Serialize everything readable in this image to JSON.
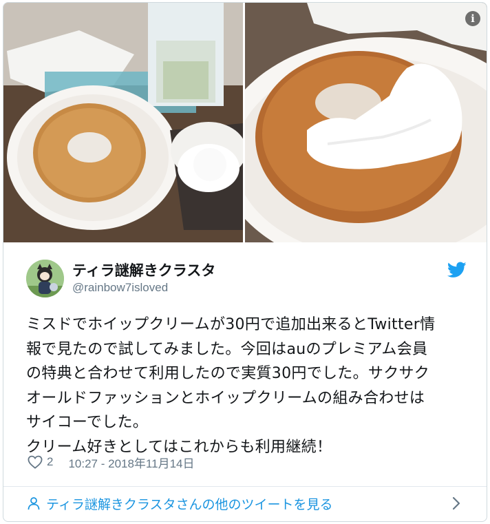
{
  "media": {
    "left_alt": "donut-and-cream-photo",
    "right_alt": "donut-with-whipped-cream-photo",
    "info_glyph": "i"
  },
  "tweet": {
    "display_name": "ティラ謎解きクラスタ",
    "handle": "@rainbow7isloved",
    "text": "ミスドでホイップクリームが30円で追加出来るとTwitter情\n報で見たので試してみました。今回はauのプレミアム会員\nの特典と合わせて利用したので実質30円でした。サクサク\nオールドファッションとホイップクリームの組み合わせは\nサイコーでした。\nクリーム好きとしてはこれからも利用継続！",
    "like_count": "2",
    "timestamp": "10:27 - 2018年11月14日"
  },
  "footer": {
    "more_tweets_label": "ティラ謎解きクラスタさんの他のツイートを見る"
  },
  "colors": {
    "twitter_blue": "#1da1f2",
    "link_blue": "#1b95e0",
    "secondary_text": "#657786",
    "border": "#cfd9de"
  },
  "icons": [
    "info-icon",
    "twitter-bird-icon",
    "heart-icon",
    "person-icon",
    "chevron-right-icon"
  ]
}
